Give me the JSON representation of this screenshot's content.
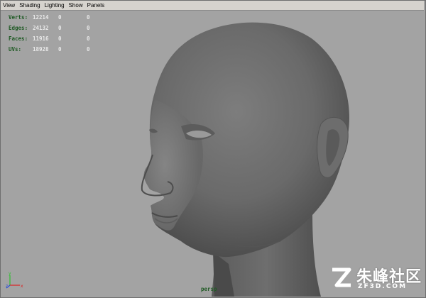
{
  "menubar": {
    "items": [
      "View",
      "Shading",
      "Lighting",
      "Show",
      "Panels"
    ]
  },
  "hud": {
    "rows": [
      {
        "label": "Verts:",
        "value": "12214",
        "c1": "0",
        "c2": "0"
      },
      {
        "label": "Edges:",
        "value": "24132",
        "c1": "0",
        "c2": "0"
      },
      {
        "label": "Faces:",
        "value": "11916",
        "c1": "0",
        "c2": "0"
      },
      {
        "label": "UVs:",
        "value": "18928",
        "c1": "0",
        "c2": "0"
      }
    ]
  },
  "viewport": {
    "camera": "persp",
    "background_color": "#a3a3a3"
  },
  "axis": {
    "x": "x",
    "y": "y",
    "z": "z"
  },
  "watermark": {
    "title": "朱峰社区",
    "subtitle": "ZF3D.COM"
  }
}
